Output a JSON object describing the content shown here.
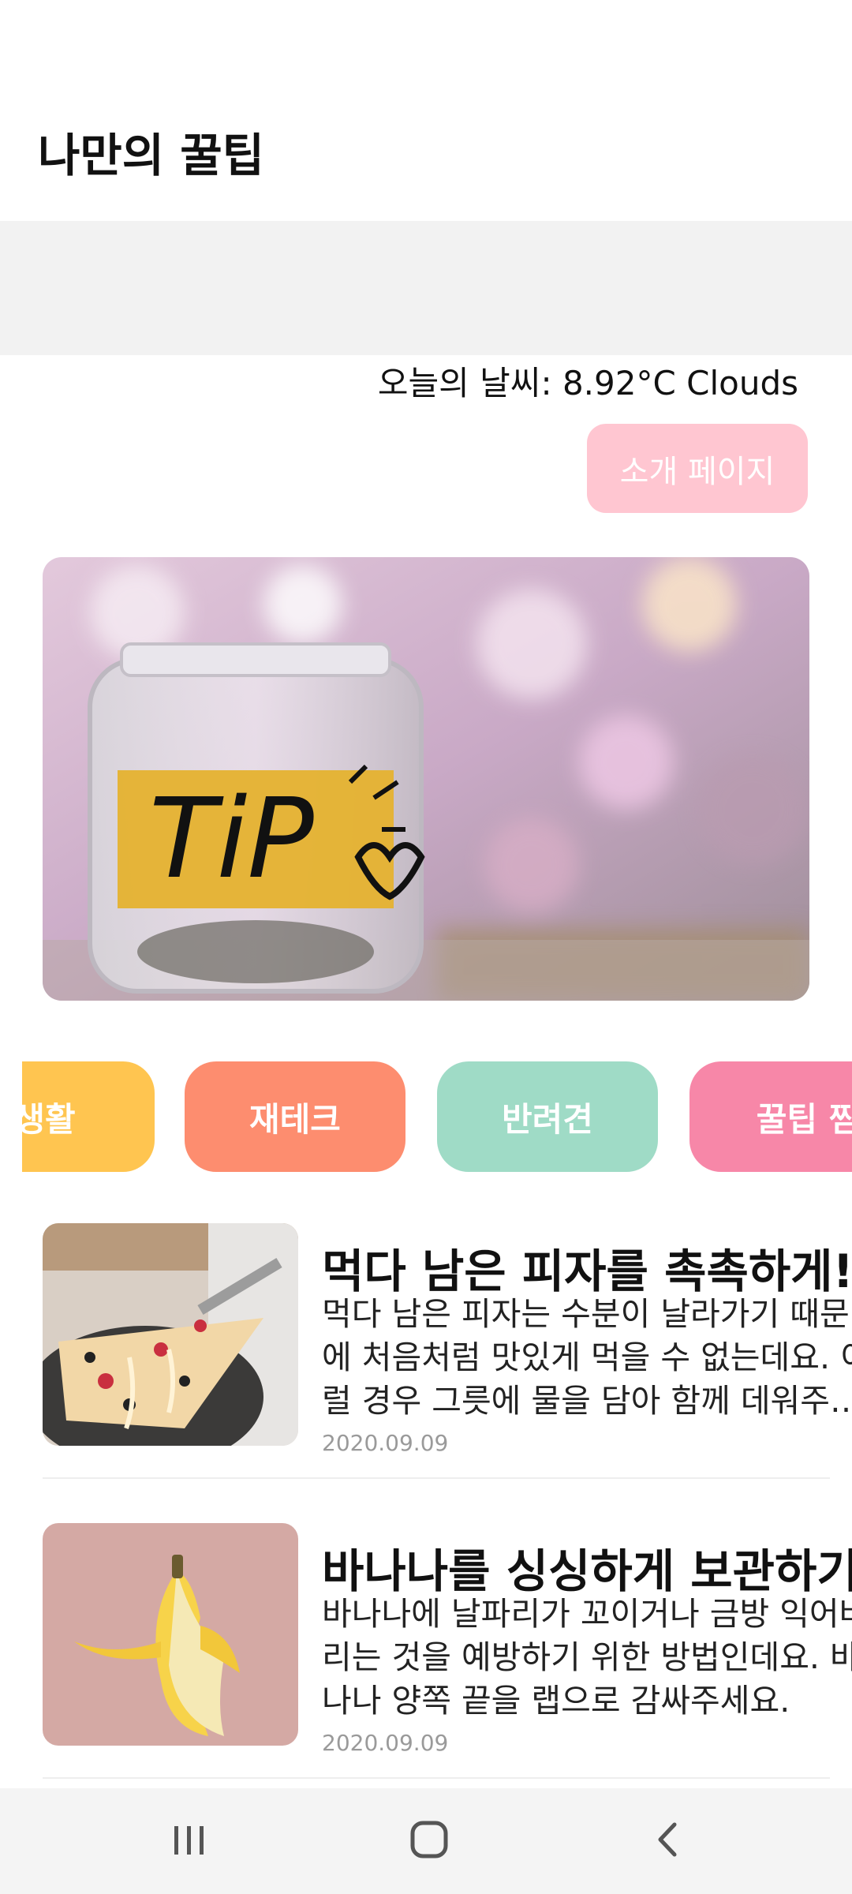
{
  "header": {
    "title": "나만의 꿀팁"
  },
  "weather": {
    "text": "오늘의 날씨: 8.92°C   Clouds"
  },
  "intro_button": {
    "label": "소개 페이지"
  },
  "hero": {
    "image_text": "TIP"
  },
  "categories": [
    {
      "label": "생활",
      "color": "#ffc550"
    },
    {
      "label": "재테크",
      "color": "#fd8d6f"
    },
    {
      "label": "반려견",
      "color": "#9fdbc6"
    },
    {
      "label": "꿀팁 찜",
      "color": "#f787a8"
    }
  ],
  "articles": [
    {
      "title": "먹다 남은 피자를 촉촉하게!",
      "summary": "먹다 남은 피자는 수분이 날라가기 때문에 처음처럼 맛있게 먹을 수 없는데요. 이럴 경우 그릇에 물을 담아 함께 데워주세요.",
      "date": "2020.09.09",
      "thumbnail": "pizza"
    },
    {
      "title": "바나나를 싱싱하게 보관하기",
      "summary": "바나나에 날파리가 꼬이거나 금방 익어버리는 것을 예방하기 위한 방법인데요. 바나나 양쪽 끝을 랩으로 감싸주세요.",
      "date": "2020.09.09",
      "thumbnail": "banana"
    }
  ],
  "nav": {
    "recents": "recents-icon",
    "home": "home-icon",
    "back": "back-icon"
  }
}
